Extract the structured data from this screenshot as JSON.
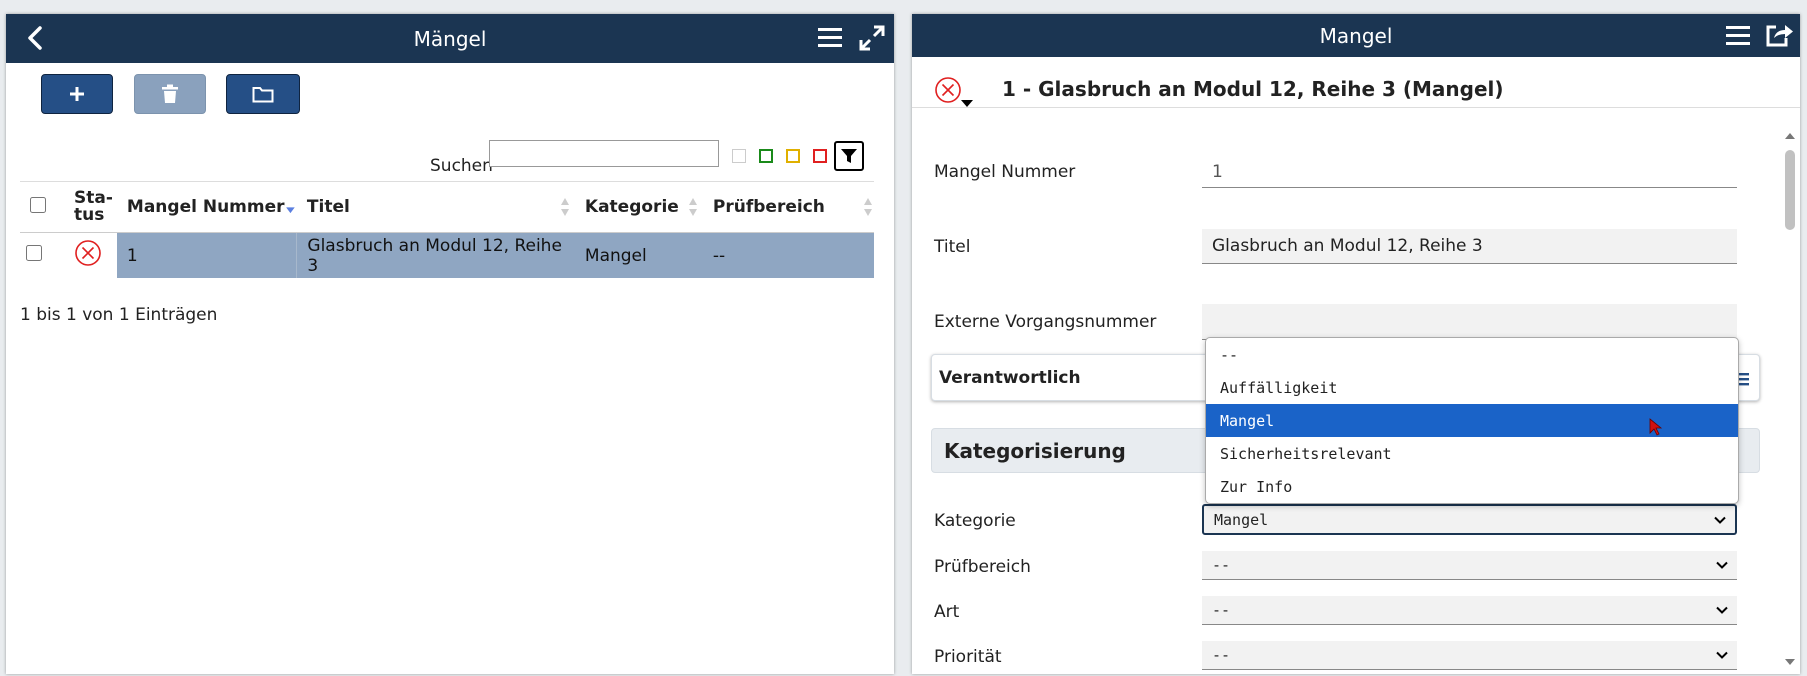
{
  "left_panel": {
    "title": "Mängel",
    "search_label": "Suchen",
    "search_value": "",
    "columns": [
      "Sta-\ntus",
      "Mangel Nummer",
      "Titel",
      "Kategorie",
      "Prüfbereich"
    ],
    "rows": [
      {
        "status": "error",
        "nummer": "1",
        "titel": "Glasbruch an Modul 12, Reihe 3",
        "kategorie": "Mangel",
        "pruefbereich": "--"
      }
    ],
    "info": "1 bis 1 von 1 Einträgen",
    "filter_colors": [
      "#cccccc",
      "#1a8a1a",
      "#e0b000",
      "#e02020"
    ]
  },
  "right_panel": {
    "title": "Mangel",
    "detail_title": "1 - Glasbruch an Modul 12, Reihe 3 (Mangel)",
    "fields": {
      "nummer_label": "Mangel Nummer",
      "nummer_value": "1",
      "titel_label": "Titel",
      "titel_value": "Glasbruch an Modul 12, Reihe 3",
      "extern_label": "Externe Vorgangsnummer",
      "extern_value": ""
    },
    "section_verantwortlich": "Verantwortlich",
    "section_kategorisierung": "Kategorisierung",
    "kategorie_label": "Kategorie",
    "kategorie_value": "Mangel",
    "kategorie_options": [
      "--",
      "Auffälligkeit",
      "Mangel",
      "Sicherheitsrelevant",
      "Zur Info"
    ],
    "pruefbereich_label": "Prüfbereich",
    "pruefbereich_value": "--",
    "art_label": "Art",
    "art_value": "--",
    "prioritaet_label": "Priorität",
    "prioritaet_value": "--"
  },
  "colors": {
    "header": "#1b3552",
    "accent": "#254f86",
    "row_highlight": "#8fa6c2",
    "dropdown_selected": "#1a63c8",
    "status_error": "#e02020"
  }
}
